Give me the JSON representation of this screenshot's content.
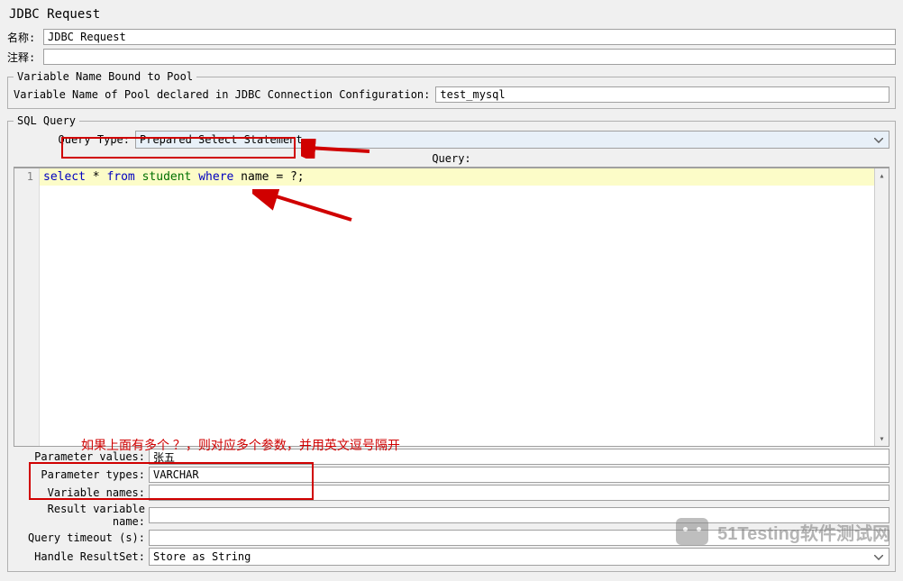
{
  "title": "JDBC Request",
  "name": {
    "label": "名称:",
    "value": "JDBC Request"
  },
  "comment": {
    "label": "注释:",
    "value": ""
  },
  "pool": {
    "legend": "Variable Name Bound to Pool",
    "label": "Variable Name of Pool declared in JDBC Connection Configuration:",
    "value": "test_mysql"
  },
  "sql": {
    "legend": "SQL Query",
    "queryTypeLabel": "Query Type:",
    "queryTypeValue": "Prepared Select Statement",
    "queryHeader": "Query:",
    "lineNumber": "1",
    "sqlTokens": {
      "t1": "select",
      "t2": " * ",
      "t3": "from",
      "t4": " student ",
      "t5": "where",
      "t6": " name = ?;"
    }
  },
  "params": {
    "valuesLabel": "Parameter values:",
    "valuesValue": "张五",
    "typesLabel": "Parameter types:",
    "typesValue": "VARCHAR",
    "varNamesLabel": "Variable names:",
    "varNamesValue": "",
    "resultVarLabel": "Result variable name:",
    "resultVarValue": "",
    "timeoutLabel": "Query timeout (s):",
    "timeoutValue": "",
    "handleLabel": "Handle ResultSet:",
    "handleValue": "Store as String"
  },
  "hint": "如果上面有多个 ？，则对应多个参数，并用英文逗号隔开",
  "watermark": "51Testing软件测试网"
}
